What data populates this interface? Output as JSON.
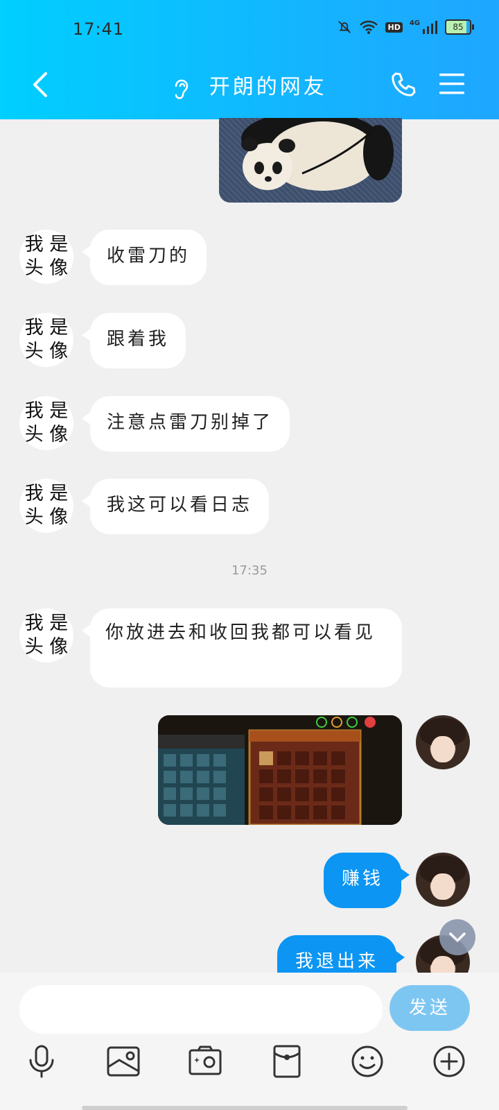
{
  "status_bar": {
    "time": "17:41",
    "hd": "HD",
    "network": "4G",
    "battery": "85"
  },
  "header": {
    "title": "开朗的网友",
    "icons": {
      "back": "chevron-left-icon",
      "ear": "ear-icon",
      "call": "phone-icon",
      "menu": "menu-icon"
    }
  },
  "messages": [
    {
      "type": "incoming",
      "avatar_text": "我 是 头 像",
      "text": "收雷刀的"
    },
    {
      "type": "incoming",
      "avatar_text": "我 是 头 像",
      "text": "跟着我"
    },
    {
      "type": "incoming",
      "avatar_text": "我 是 头 像",
      "text": "注意点雷刀别掉了"
    },
    {
      "type": "incoming",
      "avatar_text": "我 是 头 像",
      "text": "我这可以看日志"
    },
    {
      "type": "incoming",
      "avatar_text": "我 是 头 像",
      "text": "你放进去和收回我都可以看见"
    },
    {
      "type": "outgoing",
      "text": "赚钱"
    },
    {
      "type": "outgoing",
      "text": "我退出来"
    }
  ],
  "timestamp": "17:35",
  "input": {
    "placeholder": "",
    "send_label": "发送"
  },
  "toolbar_icons": [
    "microphone-icon",
    "image-icon",
    "camera-icon",
    "red-envelope-icon",
    "emoji-icon",
    "plus-icon"
  ],
  "colors": {
    "header_start": "#00cfff",
    "header_end": "#1fa6ff",
    "outgoing_bubble": "#0c95f2",
    "send_button": "#7ec6f2"
  }
}
